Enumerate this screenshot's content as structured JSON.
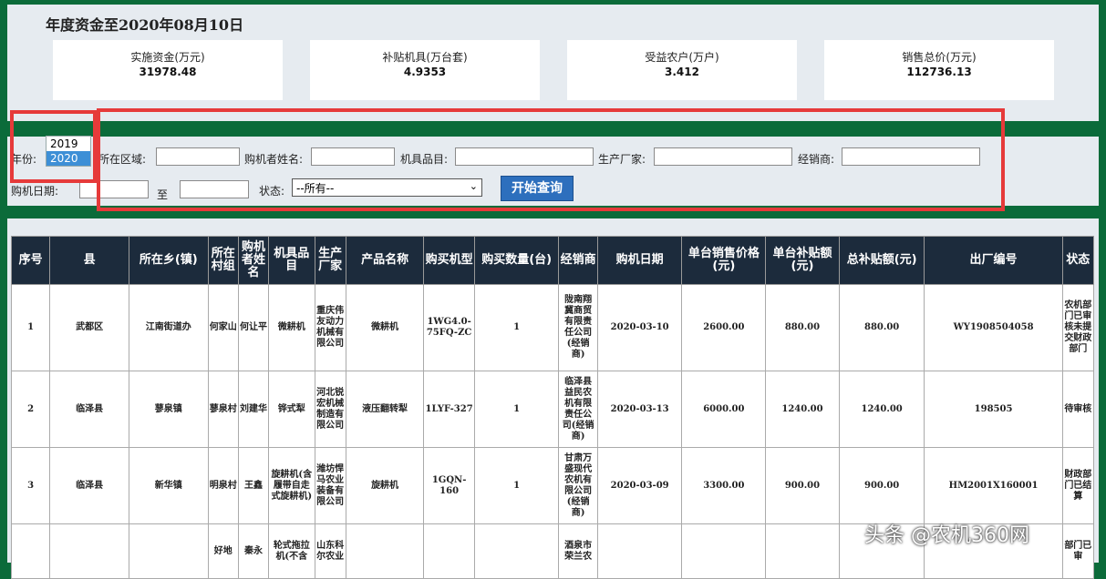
{
  "page": {
    "title": "年度资金至2020年08月10日"
  },
  "stats": [
    {
      "label": "实施资金(万元)",
      "value": "31978.48"
    },
    {
      "label": "补贴机具(万台套)",
      "value": "4.9353"
    },
    {
      "label": "受益农户(万户)",
      "value": "3.412"
    },
    {
      "label": "销售总价(万元)",
      "value": "112736.13"
    }
  ],
  "search": {
    "year_label": "年份:",
    "year_options": [
      "2019",
      "2020"
    ],
    "year_selected": "2020",
    "region_label": "所在区域:",
    "buyer_label": "购机者姓名:",
    "item_label": "机具品目:",
    "maker_label": "生产厂家:",
    "dealer_label": "经销商:",
    "date_label": "购机日期:",
    "date_to": "至",
    "status_label": "状态:",
    "status_value": "--所有--",
    "submit": "开始查询"
  },
  "table": {
    "headers": [
      "序号",
      "县",
      "所在乡(镇)",
      "所在村组",
      "购机者姓名",
      "机具品目",
      "生产厂家",
      "产品名称",
      "购买机型",
      "购买数量(台)",
      "经销商",
      "购机日期",
      "单台销售价格(元)",
      "单台补贴额(元)",
      "总补贴额(元)",
      "出厂编号",
      "状态"
    ],
    "rows": [
      [
        "1",
        "武都区",
        "江南街道办",
        "何家山",
        "何让平",
        "微耕机",
        "重庆伟友动力机械有限公司",
        "微耕机",
        "1WG4.0-75FQ-ZC",
        "1",
        "陇南翔冀商贸有限责任公司(经销商)",
        "2020-03-10",
        "2600.00",
        "880.00",
        "880.00",
        "WY1908504058",
        "农机部门已审核未提交财政部门"
      ],
      [
        "2",
        "临泽县",
        "蓼泉镇",
        "蓼泉村",
        "刘建华",
        "铧式犁",
        "河北锐宏机械制造有限公司",
        "液压翻转犁",
        "1LYF-327",
        "1",
        "临泽县益民农机有限责任公司(经销商)",
        "2020-03-13",
        "6000.00",
        "1240.00",
        "1240.00",
        "198505",
        "待审核"
      ],
      [
        "3",
        "临泽县",
        "新华镇",
        "明泉村",
        "王鑫",
        "旋耕机(含履带自走式旋耕机)",
        "潍坊悍马农业装备有限公司",
        "旋耕机",
        "1GQN-160",
        "1",
        "甘肃万盛现代农机有限公司(经销商)",
        "2020-03-09",
        "3300.00",
        "900.00",
        "900.00",
        "HM2001X160001",
        "财政部门已结算"
      ],
      [
        "",
        "",
        "",
        "好地",
        "秦永",
        "轮式拖拉机(不含",
        "山东科尔农业",
        "",
        "",
        "",
        "酒泉市荣兰农",
        "",
        "",
        "",
        "",
        "",
        "部门已审"
      ]
    ]
  },
  "watermark": "头条 @农机360网"
}
